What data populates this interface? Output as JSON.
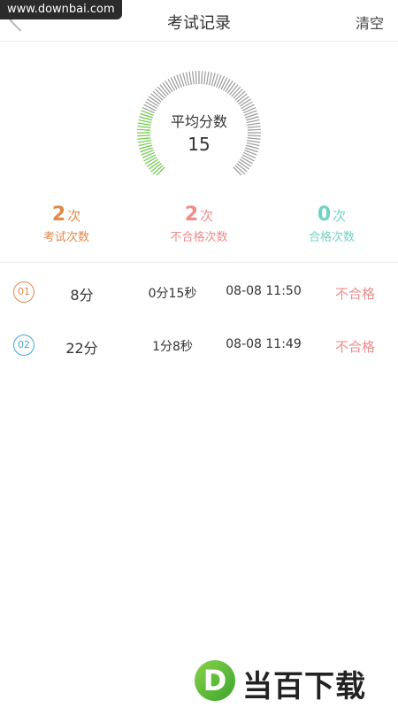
{
  "watermark_top": "www.downbai.com",
  "header": {
    "title": "考试记录",
    "clear_label": "清空"
  },
  "gauge": {
    "label": "平均分数",
    "value": "15",
    "fill_fraction": 0.15
  },
  "stats": [
    {
      "num": "2",
      "unit": "次",
      "label": "考试次数",
      "color": "#e0894a"
    },
    {
      "num": "2",
      "unit": "次",
      "label": "不合格次数",
      "color": "#ef8c8c"
    },
    {
      "num": "0",
      "unit": "次",
      "label": "合格次数",
      "color": "#6fd3c7"
    }
  ],
  "records": [
    {
      "index": "01",
      "score": "8分",
      "duration": "0分15秒",
      "date": "08-08 11:50",
      "result": "不合格",
      "index_color": "#e0894a"
    },
    {
      "index": "02",
      "score": "22分",
      "duration": "1分8秒",
      "date": "08-08 11:49",
      "result": "不合格",
      "index_color": "#3fa9d9"
    }
  ],
  "watermark_bottom": {
    "badge": "D",
    "text": "当百下载"
  }
}
